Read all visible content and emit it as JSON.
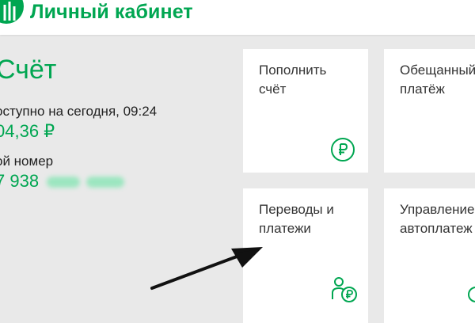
{
  "header": {
    "title": "Личный кабинет",
    "logo_icon": "megafon-logo-icon"
  },
  "account": {
    "title": "Счёт",
    "available_label": "оступно на сегодня, 09:24",
    "balance": "04,36 ₽",
    "number_label": "ой номер",
    "number_prefix": "7 938"
  },
  "tiles": [
    {
      "label": "Пополнить\nсчёт",
      "icon": "ruble-icon"
    },
    {
      "label": "Обещанный\nплатёж",
      "icon": ""
    },
    {
      "label": "Переводы и\nплатежи",
      "icon": "person-ruble-icon"
    },
    {
      "label": "Управление\nавтоплатеж",
      "icon": ""
    }
  ],
  "colors": {
    "brand": "#00a651",
    "background": "#e9e9e9",
    "tile": "#ffffff",
    "text": "#333333"
  }
}
